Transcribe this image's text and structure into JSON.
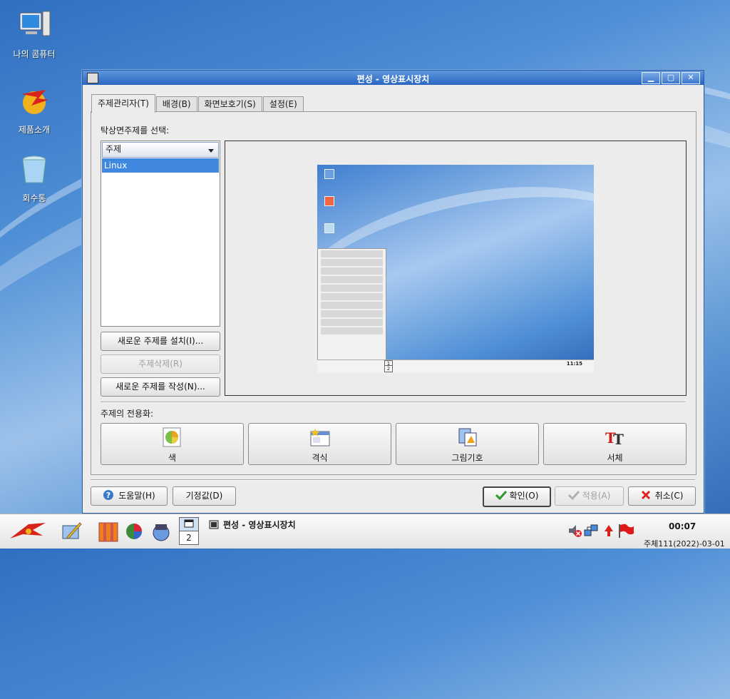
{
  "desktop": {
    "icons": [
      {
        "label": "나의 콤퓨터",
        "icon": "computer-icon"
      },
      {
        "label": "제품소개",
        "icon": "product-intro-icon"
      },
      {
        "label": "회수통",
        "icon": "trash-icon"
      }
    ]
  },
  "window": {
    "title": "편성 - 영상표시장치",
    "controls": {
      "minimize": "▁",
      "maximize": "▢",
      "close": "✕"
    },
    "tabs": [
      "주제관리자(T)",
      "배경(B)",
      "화면보호기(S)",
      "설정(E)"
    ],
    "active_tab": 0,
    "theme_section": {
      "label": "탁상면주제를 선택:",
      "combo_value": "주제",
      "list_items": [
        "Linux"
      ],
      "buttons": {
        "install": "새로운 주제를 설치(I)...",
        "delete": "주제삭제(R)",
        "create": "새로운 주제를 작성(N)..."
      }
    },
    "customize": {
      "label": "주제의 전용화:",
      "buttons": [
        "색",
        "격식",
        "그림기호",
        "서체"
      ]
    },
    "footer": {
      "help": "도움말(H)",
      "defaults": "기정값(D)",
      "ok": "확인(O)",
      "apply": "적용(A)",
      "cancel": "취소(C)"
    },
    "preview": {
      "clock": "11:15",
      "pager_number": "1",
      "pager_number_2": "2"
    }
  },
  "taskbar": {
    "task_title": "편성 - 영상표시장치",
    "pager": "2",
    "clock": "00:07",
    "date": "주체111(2022)-03-01"
  },
  "colors": {
    "titlebar": "#2a67c0",
    "selection": "#3f87df",
    "desktop": "#4f8fd6"
  }
}
